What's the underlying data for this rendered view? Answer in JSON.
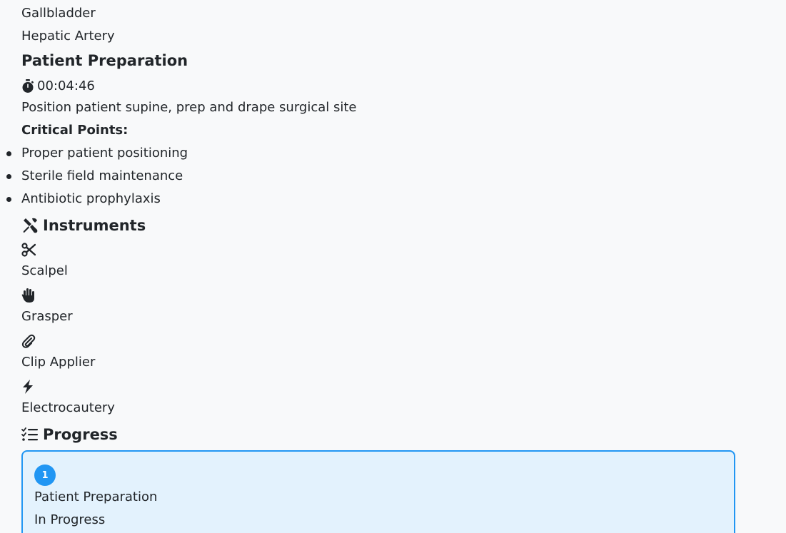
{
  "anatomy": [
    "Gallbladder",
    "Hepatic Artery"
  ],
  "step": {
    "title": "Patient Preparation",
    "timer": "00:04:46",
    "description": "Position patient supine, prep and drape surgical site",
    "critical_label": "Critical Points:",
    "critical_points": [
      "Proper patient positioning",
      "Sterile field maintenance",
      "Antibiotic prophylaxis"
    ]
  },
  "instruments": {
    "heading": "Instruments",
    "heading_icon": "tools-icon",
    "items": [
      {
        "icon": "scissors-icon",
        "label": "Scalpel"
      },
      {
        "icon": "hand-icon",
        "label": "Grasper"
      },
      {
        "icon": "paperclip-icon",
        "label": "Clip Applier"
      },
      {
        "icon": "bolt-icon",
        "label": "Electrocautery"
      }
    ]
  },
  "progress": {
    "heading": "Progress",
    "heading_icon": "list-check-icon",
    "steps": [
      {
        "number": "1",
        "title": "Patient Preparation",
        "status": "In Progress"
      }
    ]
  },
  "colors": {
    "accent": "#2196f3",
    "card_bg": "#e3f2fd",
    "text": "#212529",
    "page_bg": "#f8f9fa"
  }
}
